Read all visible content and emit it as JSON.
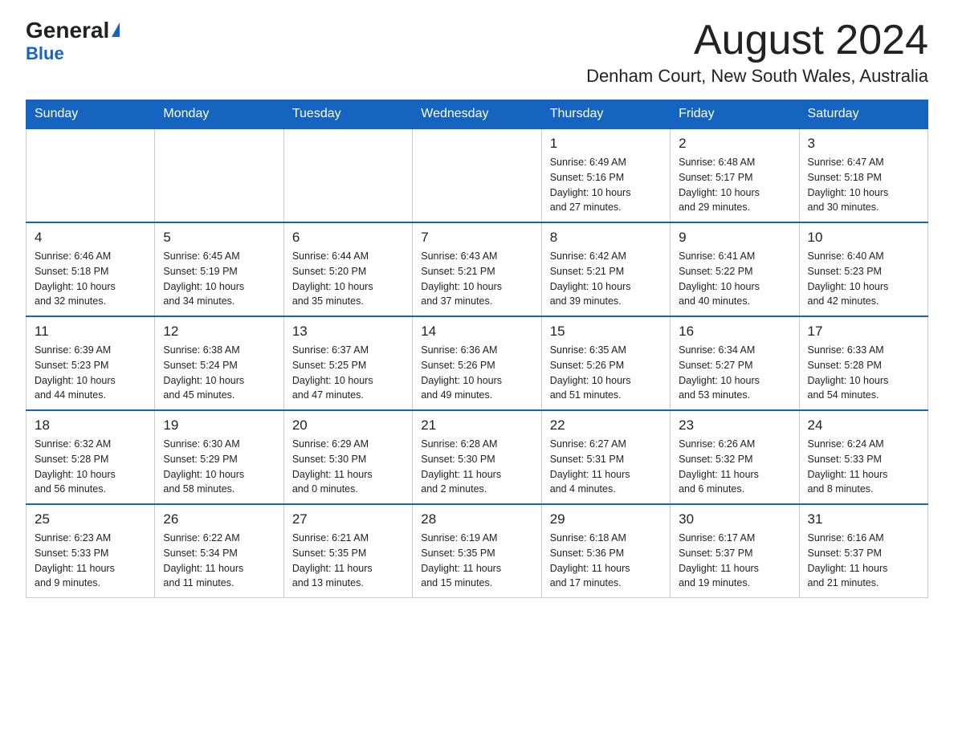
{
  "logo": {
    "text_general": "General",
    "text_blue": "Blue"
  },
  "header": {
    "month_year": "August 2024",
    "location": "Denham Court, New South Wales, Australia"
  },
  "days_of_week": [
    "Sunday",
    "Monday",
    "Tuesday",
    "Wednesday",
    "Thursday",
    "Friday",
    "Saturday"
  ],
  "weeks": [
    [
      {
        "day": "",
        "info": ""
      },
      {
        "day": "",
        "info": ""
      },
      {
        "day": "",
        "info": ""
      },
      {
        "day": "",
        "info": ""
      },
      {
        "day": "1",
        "info": "Sunrise: 6:49 AM\nSunset: 5:16 PM\nDaylight: 10 hours\nand 27 minutes."
      },
      {
        "day": "2",
        "info": "Sunrise: 6:48 AM\nSunset: 5:17 PM\nDaylight: 10 hours\nand 29 minutes."
      },
      {
        "day": "3",
        "info": "Sunrise: 6:47 AM\nSunset: 5:18 PM\nDaylight: 10 hours\nand 30 minutes."
      }
    ],
    [
      {
        "day": "4",
        "info": "Sunrise: 6:46 AM\nSunset: 5:18 PM\nDaylight: 10 hours\nand 32 minutes."
      },
      {
        "day": "5",
        "info": "Sunrise: 6:45 AM\nSunset: 5:19 PM\nDaylight: 10 hours\nand 34 minutes."
      },
      {
        "day": "6",
        "info": "Sunrise: 6:44 AM\nSunset: 5:20 PM\nDaylight: 10 hours\nand 35 minutes."
      },
      {
        "day": "7",
        "info": "Sunrise: 6:43 AM\nSunset: 5:21 PM\nDaylight: 10 hours\nand 37 minutes."
      },
      {
        "day": "8",
        "info": "Sunrise: 6:42 AM\nSunset: 5:21 PM\nDaylight: 10 hours\nand 39 minutes."
      },
      {
        "day": "9",
        "info": "Sunrise: 6:41 AM\nSunset: 5:22 PM\nDaylight: 10 hours\nand 40 minutes."
      },
      {
        "day": "10",
        "info": "Sunrise: 6:40 AM\nSunset: 5:23 PM\nDaylight: 10 hours\nand 42 minutes."
      }
    ],
    [
      {
        "day": "11",
        "info": "Sunrise: 6:39 AM\nSunset: 5:23 PM\nDaylight: 10 hours\nand 44 minutes."
      },
      {
        "day": "12",
        "info": "Sunrise: 6:38 AM\nSunset: 5:24 PM\nDaylight: 10 hours\nand 45 minutes."
      },
      {
        "day": "13",
        "info": "Sunrise: 6:37 AM\nSunset: 5:25 PM\nDaylight: 10 hours\nand 47 minutes."
      },
      {
        "day": "14",
        "info": "Sunrise: 6:36 AM\nSunset: 5:26 PM\nDaylight: 10 hours\nand 49 minutes."
      },
      {
        "day": "15",
        "info": "Sunrise: 6:35 AM\nSunset: 5:26 PM\nDaylight: 10 hours\nand 51 minutes."
      },
      {
        "day": "16",
        "info": "Sunrise: 6:34 AM\nSunset: 5:27 PM\nDaylight: 10 hours\nand 53 minutes."
      },
      {
        "day": "17",
        "info": "Sunrise: 6:33 AM\nSunset: 5:28 PM\nDaylight: 10 hours\nand 54 minutes."
      }
    ],
    [
      {
        "day": "18",
        "info": "Sunrise: 6:32 AM\nSunset: 5:28 PM\nDaylight: 10 hours\nand 56 minutes."
      },
      {
        "day": "19",
        "info": "Sunrise: 6:30 AM\nSunset: 5:29 PM\nDaylight: 10 hours\nand 58 minutes."
      },
      {
        "day": "20",
        "info": "Sunrise: 6:29 AM\nSunset: 5:30 PM\nDaylight: 11 hours\nand 0 minutes."
      },
      {
        "day": "21",
        "info": "Sunrise: 6:28 AM\nSunset: 5:30 PM\nDaylight: 11 hours\nand 2 minutes."
      },
      {
        "day": "22",
        "info": "Sunrise: 6:27 AM\nSunset: 5:31 PM\nDaylight: 11 hours\nand 4 minutes."
      },
      {
        "day": "23",
        "info": "Sunrise: 6:26 AM\nSunset: 5:32 PM\nDaylight: 11 hours\nand 6 minutes."
      },
      {
        "day": "24",
        "info": "Sunrise: 6:24 AM\nSunset: 5:33 PM\nDaylight: 11 hours\nand 8 minutes."
      }
    ],
    [
      {
        "day": "25",
        "info": "Sunrise: 6:23 AM\nSunset: 5:33 PM\nDaylight: 11 hours\nand 9 minutes."
      },
      {
        "day": "26",
        "info": "Sunrise: 6:22 AM\nSunset: 5:34 PM\nDaylight: 11 hours\nand 11 minutes."
      },
      {
        "day": "27",
        "info": "Sunrise: 6:21 AM\nSunset: 5:35 PM\nDaylight: 11 hours\nand 13 minutes."
      },
      {
        "day": "28",
        "info": "Sunrise: 6:19 AM\nSunset: 5:35 PM\nDaylight: 11 hours\nand 15 minutes."
      },
      {
        "day": "29",
        "info": "Sunrise: 6:18 AM\nSunset: 5:36 PM\nDaylight: 11 hours\nand 17 minutes."
      },
      {
        "day": "30",
        "info": "Sunrise: 6:17 AM\nSunset: 5:37 PM\nDaylight: 11 hours\nand 19 minutes."
      },
      {
        "day": "31",
        "info": "Sunrise: 6:16 AM\nSunset: 5:37 PM\nDaylight: 11 hours\nand 21 minutes."
      }
    ]
  ]
}
